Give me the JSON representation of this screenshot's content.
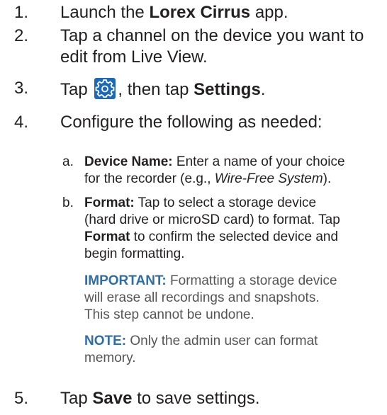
{
  "steps": [
    {
      "num": "1.",
      "pre": "Launch the ",
      "bold": "Lorex Cirrus",
      "post": " app."
    },
    {
      "num": "2.",
      "line1": "Tap a channel on the device you want to",
      "line2": "edit from Live View."
    },
    {
      "num": "3.",
      "pre": "Tap ",
      "icon": "settings-gear-icon",
      "mid": ", then tap ",
      "bold": "Settings",
      "post": "."
    },
    {
      "num": "4.",
      "text": "Configure the following as needed:"
    },
    {
      "num": "5.",
      "pre": "Tap ",
      "bold": "Save",
      "post": " to save settings."
    }
  ],
  "substeps": {
    "a": {
      "letter": "a.",
      "bold": "Device Name:",
      "line1_rest": " Enter a name of your choice",
      "line2_pre": "for the recorder (e.g., ",
      "italic": "Wire-Free System",
      "line2_post": ")."
    },
    "b": {
      "letter": "b.",
      "bold": "Format:",
      "line1_rest": " Tap to select a storage device",
      "line2": "(hard drive or microSD card) to format. Tap",
      "line3_bold": "Format",
      "line3_rest": " to confirm the selected device and",
      "line4": "begin formatting."
    }
  },
  "important": {
    "head": "IMPORTANT:",
    "line1_rest": " Formatting a storage device",
    "line2": "will erase all recordings and snapshots.",
    "line3": "This step cannot be undone."
  },
  "note": {
    "head": "NOTE:",
    "line1_rest": " Only the admin user can format",
    "line2": "memory."
  },
  "colors": {
    "text": "#231f20",
    "callout_head": "#2f6da8",
    "icon_bg": "#1c69b9"
  }
}
